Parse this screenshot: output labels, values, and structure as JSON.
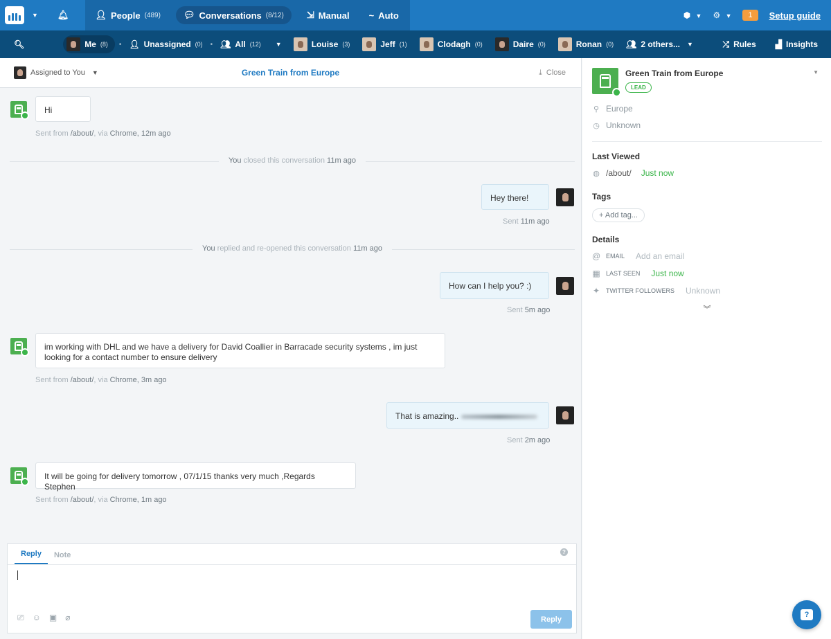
{
  "topnav": {
    "people_label": "People",
    "people_count": "(489)",
    "conversations_label": "Conversations",
    "conversations_count": "(8/12)",
    "manual_label": "Manual",
    "auto_label": "Auto",
    "setup_count": "1",
    "setup_label": "Setup guide"
  },
  "subnav": {
    "me_label": "Me",
    "me_count": "(8)",
    "unassigned_label": "Unassigned",
    "unassigned_count": "(0)",
    "all_label": "All",
    "all_count": "(12)",
    "people": [
      {
        "name": "Louise",
        "count": "(3)"
      },
      {
        "name": "Jeff",
        "count": "(1)"
      },
      {
        "name": "Clodagh",
        "count": "(0)"
      },
      {
        "name": "Daire",
        "count": "(0)"
      },
      {
        "name": "Ronan",
        "count": "(0)"
      }
    ],
    "others_label": "2 others...",
    "rules_label": "Rules",
    "insights_label": "Insights"
  },
  "conversation": {
    "assigned_label": "Assigned to You",
    "title": "Green Train from Europe",
    "close_label": "Close",
    "messages": [
      {
        "text": "Hi",
        "meta_prefix": "Sent from ",
        "meta_path": "/about/",
        "meta_via": ", via ",
        "meta_browser": "Chrome",
        "meta_time": ", 12m ago"
      },
      {
        "text": "Hey there!",
        "meta_prefix": "Sent ",
        "meta_time": "11m ago"
      },
      {
        "text": "How can I help you? :)",
        "meta_prefix": "Sent ",
        "meta_time": "5m ago"
      },
      {
        "text": "im working with DHL and we have a delivery for David Coallier in Barracade security systems , im just looking for a contact number to ensure delivery",
        "meta_prefix": "Sent from ",
        "meta_path": "/about/",
        "meta_via": ", via ",
        "meta_browser": "Chrome",
        "meta_time": ", 3m ago"
      },
      {
        "text": "That is amazing..",
        "meta_prefix": "Sent ",
        "meta_time": "2m ago"
      },
      {
        "text": "It will be going for delivery tomorrow , 07/1/15 thanks very much ,Regards Stephen",
        "meta_prefix": "Sent from ",
        "meta_path": "/about/",
        "meta_via": ", via ",
        "meta_browser": "Chrome",
        "meta_time": ", 1m ago"
      }
    ],
    "events": [
      {
        "who": "You",
        "action": " closed this conversation ",
        "time": "11m ago"
      },
      {
        "who": "You",
        "action": " replied and re-opened this conversation ",
        "time": "11m ago"
      }
    ]
  },
  "composer": {
    "tab_reply": "Reply",
    "tab_note": "Note",
    "help": "?",
    "send_label": "Reply"
  },
  "profile": {
    "name": "Green Train from Europe",
    "badge": "LEAD",
    "location": "Europe",
    "timezone": "Unknown",
    "last_viewed_title": "Last Viewed",
    "last_viewed_path": "/about/",
    "last_viewed_time": "Just now",
    "tags_title": "Tags",
    "add_tag_label": "Add tag...",
    "details_title": "Details",
    "email_label": "EMAIL",
    "email_value": "Add an email",
    "last_seen_label": "LAST SEEN",
    "last_seen_value": "Just now",
    "twitter_label": "TWITTER FOLLOWERS",
    "twitter_value": "Unknown"
  },
  "help_fab": "?"
}
